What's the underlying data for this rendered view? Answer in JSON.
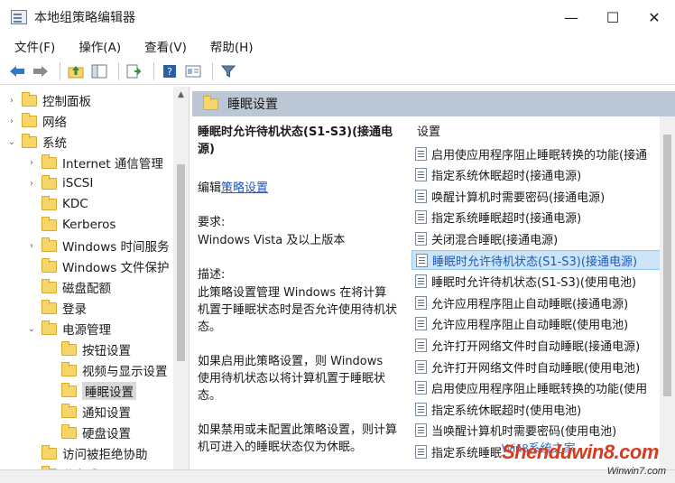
{
  "window": {
    "title": "本地组策略编辑器",
    "minimize": "—",
    "maximize": "☐",
    "close": "✕"
  },
  "menu": [
    "文件(F)",
    "操作(A)",
    "查看(V)",
    "帮助(H)"
  ],
  "toolbar": [
    "back-arrow-icon",
    "forward-arrow-icon",
    "up-folder-icon",
    "show-hide-tree-icon",
    "export-list-icon",
    "help-icon",
    "properties-icon",
    "filter-icon"
  ],
  "tree": [
    {
      "label": "控制面板",
      "level": 1,
      "arrow": "›",
      "selected": false
    },
    {
      "label": "网络",
      "level": 1,
      "arrow": "›",
      "selected": false
    },
    {
      "label": "系统",
      "level": 1,
      "arrow": "⌄",
      "selected": false
    },
    {
      "label": "Internet 通信管理",
      "level": 2,
      "arrow": "›",
      "selected": false
    },
    {
      "label": "iSCSI",
      "level": 2,
      "arrow": "›",
      "selected": false
    },
    {
      "label": "KDC",
      "level": 2,
      "arrow": "",
      "selected": false
    },
    {
      "label": "Kerberos",
      "level": 2,
      "arrow": "",
      "selected": false
    },
    {
      "label": "Windows 时间服务",
      "level": 2,
      "arrow": "›",
      "selected": false
    },
    {
      "label": "Windows 文件保护",
      "level": 2,
      "arrow": "",
      "selected": false
    },
    {
      "label": "磁盘配额",
      "level": 2,
      "arrow": "",
      "selected": false
    },
    {
      "label": "登录",
      "level": 2,
      "arrow": "",
      "selected": false
    },
    {
      "label": "电源管理",
      "level": 2,
      "arrow": "⌄",
      "selected": false
    },
    {
      "label": "按钮设置",
      "level": 3,
      "arrow": "",
      "selected": false
    },
    {
      "label": "视频与显示设置",
      "level": 3,
      "arrow": "",
      "selected": false
    },
    {
      "label": "睡眠设置",
      "level": 3,
      "arrow": "",
      "selected": true
    },
    {
      "label": "通知设置",
      "level": 3,
      "arrow": "",
      "selected": false
    },
    {
      "label": "硬盘设置",
      "level": 3,
      "arrow": "",
      "selected": false
    },
    {
      "label": "访问被拒绝协助",
      "level": 2,
      "arrow": "",
      "selected": false
    },
    {
      "label": "分布式 COM",
      "level": 2,
      "arrow": "›",
      "selected": false
    }
  ],
  "header": {
    "title": "睡眠设置"
  },
  "description": {
    "policy_title": "睡眠时允许待机状态(S1-S3)(接通电源)",
    "edit_prefix": "编辑",
    "edit_link": "策略设置",
    "req_label": "要求:",
    "req_value": "Windows Vista 及以上版本",
    "desc_label": "描述:",
    "desc_p1": "此策略设置管理 Windows 在将计算机置于睡眠状态时是否允许使用待机状态。",
    "desc_p2": "如果启用此策略设置，则 Windows 使用待机状态以将计算机置于睡眠状态。",
    "desc_p3": "如果禁用或未配置此策略设置，则计算机可进入的睡眠状态仅为休眠。"
  },
  "list": {
    "column_header": "设置",
    "items": [
      {
        "label": "启用使应用程序阻止睡眠转换的功能(接通",
        "selected": false
      },
      {
        "label": "指定系统休眠超时(接通电源)",
        "selected": false
      },
      {
        "label": "唤醒计算机时需要密码(接通电源)",
        "selected": false
      },
      {
        "label": "指定系统睡眠超时(接通电源)",
        "selected": false
      },
      {
        "label": "关闭混合睡眠(接通电源)",
        "selected": false
      },
      {
        "label": "睡眠时允许待机状态(S1-S3)(接通电源)",
        "selected": true
      },
      {
        "label": "睡眠时允许待机状态(S1-S3)(使用电池)",
        "selected": false
      },
      {
        "label": "允许应用程序阻止自动睡眠(接通电源)",
        "selected": false
      },
      {
        "label": "允许应用程序阻止自动睡眠(使用电池)",
        "selected": false
      },
      {
        "label": "允许打开网络文件时自动睡眠(接通电源)",
        "selected": false
      },
      {
        "label": "允许打开网络文件时自动睡眠(使用电池)",
        "selected": false
      },
      {
        "label": "启用使应用程序阻止睡眠转换的功能(使用",
        "selected": false
      },
      {
        "label": "指定系统休眠超时(使用电池)",
        "selected": false
      },
      {
        "label": "当唤醒计算机时需要密码(使用电池)",
        "selected": false
      },
      {
        "label": "指定系统睡眠",
        "selected": false
      }
    ]
  },
  "watermark": {
    "main": "Shenduwin8.com",
    "sub": "Win8系统之家",
    "url": "Winwin7.com"
  }
}
